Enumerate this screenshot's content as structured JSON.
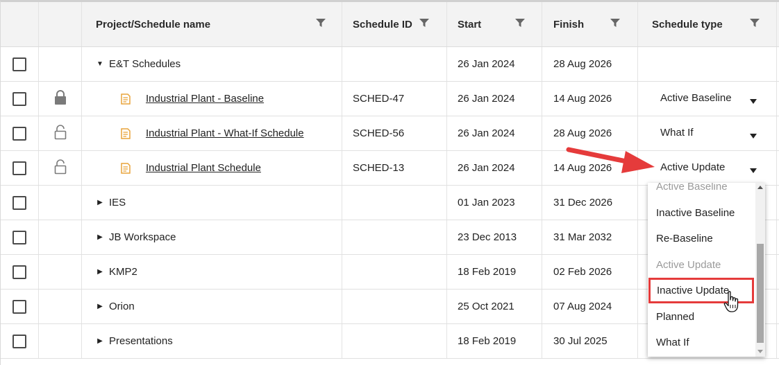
{
  "header": {
    "name": "Project/Schedule name",
    "schedule_id": "Schedule ID",
    "start": "Start",
    "finish": "Finish",
    "schedule_type": "Schedule type"
  },
  "rows": [
    {
      "kind": "group",
      "expanded": true,
      "name": "E&T Schedules",
      "id": "",
      "start": "26 Jan 2024",
      "finish": "28 Aug 2026",
      "type": ""
    },
    {
      "kind": "schedule",
      "lock": "locked",
      "name": "Industrial Plant - Baseline",
      "id": "SCHED-47",
      "start": "26 Jan 2024",
      "finish": "14 Aug 2026",
      "type": "Active Baseline"
    },
    {
      "kind": "schedule",
      "lock": "unlocked",
      "name": "Industrial Plant - What-If Schedule",
      "id": "SCHED-56",
      "start": "26 Jan 2024",
      "finish": "28 Aug 2026",
      "type": "What If"
    },
    {
      "kind": "schedule",
      "lock": "unlocked",
      "name": "Industrial Plant Schedule",
      "id": "SCHED-13",
      "start": "26 Jan 2024",
      "finish": "14 Aug 2026",
      "type": "Active Update"
    },
    {
      "kind": "group",
      "expanded": false,
      "name": "IES",
      "id": "",
      "start": "01 Jan 2023",
      "finish": "31 Dec 2026",
      "type": ""
    },
    {
      "kind": "group",
      "expanded": false,
      "name": "JB Workspace",
      "id": "",
      "start": "23 Dec 2013",
      "finish": "31 Mar 2032",
      "type": ""
    },
    {
      "kind": "group",
      "expanded": false,
      "name": "KMP2",
      "id": "",
      "start": "18 Feb 2019",
      "finish": "02 Feb 2026",
      "type": ""
    },
    {
      "kind": "group",
      "expanded": false,
      "name": "Orion",
      "id": "",
      "start": "25 Oct 2021",
      "finish": "07 Aug 2024",
      "type": ""
    },
    {
      "kind": "group",
      "expanded": false,
      "name": "Presentations",
      "id": "",
      "start": "18 Feb 2019",
      "finish": "30 Jul 2025",
      "type": ""
    }
  ],
  "dropdown": {
    "options": [
      {
        "label": "Active Baseline",
        "disabled": true
      },
      {
        "label": "Inactive Baseline",
        "disabled": false
      },
      {
        "label": "Re-Baseline",
        "disabled": false
      },
      {
        "label": "Active Update",
        "disabled": true
      },
      {
        "label": "Inactive Update",
        "disabled": false,
        "highlighted": true
      },
      {
        "label": "Planned",
        "disabled": false
      },
      {
        "label": "What If",
        "disabled": false
      }
    ]
  },
  "colors": {
    "schedule_icon": "#e8a33a",
    "annotation_red": "#e53b3b",
    "header_bg": "#f3f3f3"
  },
  "icons": {
    "filter": "funnel-icon",
    "lock": "lock-icon",
    "unlock": "unlock-icon",
    "schedule": "schedule-document-icon",
    "expand": "triangle-icon"
  }
}
